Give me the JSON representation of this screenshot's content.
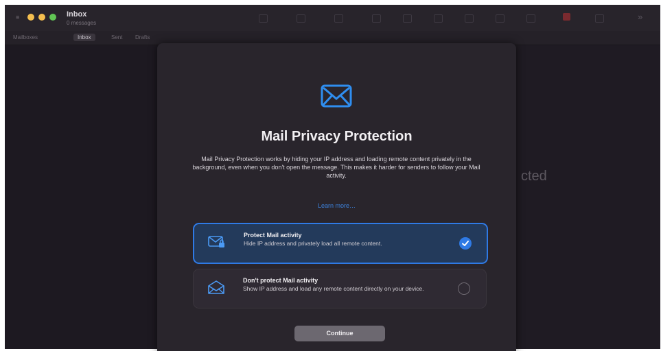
{
  "window": {
    "title": "Inbox",
    "subtitle": "0 messages"
  },
  "tabs": [
    {
      "label": "Mailboxes"
    },
    {
      "label": "Inbox"
    },
    {
      "label": "Sent"
    },
    {
      "label": "Drafts"
    }
  ],
  "background_text": "cted",
  "sheet": {
    "title": "Mail Privacy Protection",
    "description": "Mail Privacy Protection works by hiding your IP address and loading remote content privately in the background, even when you don't open the message. This makes it harder for senders to follow your Mail activity.",
    "learn_more": "Learn more…",
    "options": [
      {
        "title": "Protect Mail activity",
        "description": "Hide IP address and privately load all remote content.",
        "selected": true
      },
      {
        "title": "Don't protect Mail activity",
        "description": "Show IP address and load any remote content directly on your device.",
        "selected": false
      }
    ],
    "continue_label": "Continue"
  },
  "colors": {
    "accent": "#2f7ae5",
    "window_bg": "#1f1b22",
    "sheet_bg": "#29252c"
  },
  "icons": [
    "envelope-icon",
    "envelope-lock-icon",
    "open-envelope-icon",
    "checkmark-icon"
  ]
}
